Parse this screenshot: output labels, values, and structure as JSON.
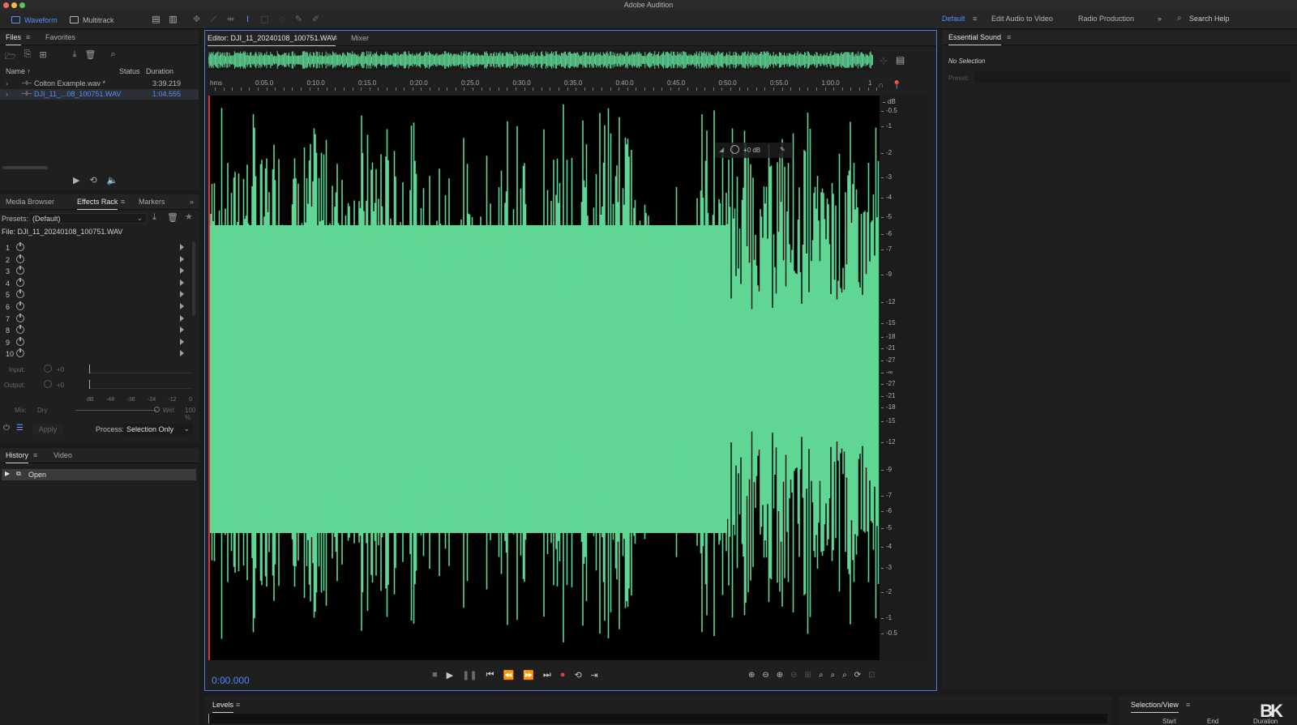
{
  "app": {
    "title": "Adobe Audition",
    "mode_waveform": "Waveform",
    "mode_multitrack": "Multitrack"
  },
  "workspaces": {
    "default": "Default",
    "edit_audio_to_video": "Edit Audio to Video",
    "radio_production": "Radio Production",
    "more": "»",
    "search_help": "Search Help"
  },
  "files_panel": {
    "tab_files": "Files",
    "tab_favorites": "Favorites",
    "col_name": "Name ↑",
    "col_status": "Status",
    "col_duration": "Duration",
    "files": [
      {
        "name": "Colton Example.wav *",
        "duration": "3:39.219"
      },
      {
        "name": "DJI_11_...08_100751.WAV",
        "duration": "1:04.555"
      }
    ]
  },
  "effects_panel": {
    "tab_media_browser": "Media Browser",
    "tab_effects_rack": "Effects Rack",
    "tab_markers": "Markers",
    "presets_label": "Presets:",
    "presets_value": "(Default)",
    "file_label": "File: DJI_11_20240108_100751.WAV",
    "slots": [
      "1",
      "2",
      "3",
      "4",
      "5",
      "6",
      "7",
      "8",
      "9",
      "10"
    ],
    "input_label": "Input:",
    "input_value": "+0",
    "output_label": "Output:",
    "output_value": "+0",
    "meter_scale": [
      "dB",
      "-48",
      "-36",
      "-24",
      "-12",
      "0"
    ],
    "mix_label": "Mix:",
    "mix_dry": "Dry",
    "mix_wet": "Wet",
    "mix_value": "100 %",
    "apply_label": "Apply",
    "process_label": "Process:",
    "process_value": "Selection Only"
  },
  "history_panel": {
    "tab_history": "History",
    "tab_video": "Video",
    "items": [
      "Open"
    ]
  },
  "editor": {
    "tab_editor": "Editor: DJI_11_20240108_100751.WAV",
    "tab_mixer": "Mixer",
    "ruler_unit": "hms",
    "ruler_ticks": [
      "0:05.0",
      "0:10.0",
      "0:15.0",
      "0:20.0",
      "0:25.0",
      "0:30.0",
      "0:35.0",
      "0:40.0",
      "0:45.0",
      "0:50.0",
      "0:55.0",
      "1:00.0"
    ],
    "ruler_end": "1",
    "db_unit": "dB",
    "db_scale_top": [
      "-0.5",
      "-1",
      "-2",
      "-3",
      "-4",
      "-5",
      "-6",
      "-7",
      "-9",
      "-12",
      "-15",
      "-18",
      "-21",
      "-27",
      "-∞"
    ],
    "db_scale_bottom": [
      "-27",
      "-21",
      "-18",
      "-15",
      "-12",
      "-9",
      "-7",
      "-6",
      "-5",
      "-4",
      "-3",
      "-2",
      "-1",
      "-0.5"
    ],
    "hud_gain": "+0 dB",
    "timecode": "0:00.000",
    "waveform_color": "#5fd694"
  },
  "essential_sound": {
    "title": "Essential Sound",
    "no_selection": "No Selection",
    "preset_label": "Preset:"
  },
  "levels": {
    "title": "Levels"
  },
  "selection_view": {
    "title": "Selection/View",
    "col_start": "Start",
    "col_end": "End",
    "col_duration": "Duration"
  },
  "logo": "BK",
  "colors": {
    "accent": "#4d86ff",
    "waveform": "#5fd694"
  }
}
